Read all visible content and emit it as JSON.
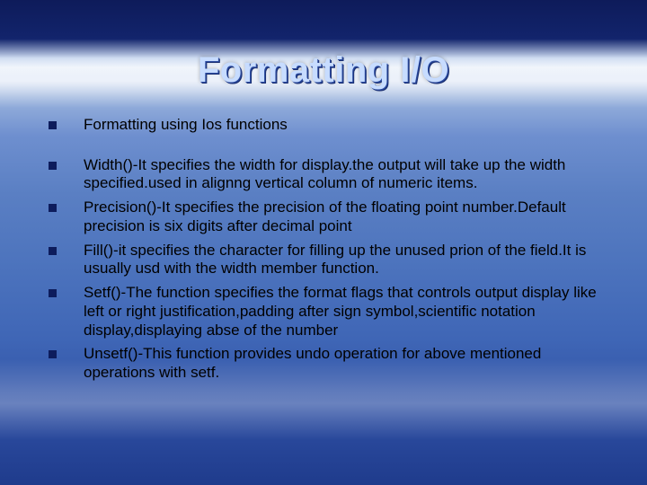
{
  "title": "Formatting I/O",
  "lead": "Formatting using Ios functions",
  "bullets": [
    "Width()-It specifies the width for display.the output will take up the width specified.used in alignng vertical column of numeric items.",
    "Precision()-It specifies the precision of the floating point number.Default precision is six digits after decimal point",
    "Fill()-it specifies the character for filling up the unused prion of the field.It is usually usd with the width member function.",
    "Setf()-The function specifies the format flags that controls output display  like left  or right justification,padding after sign symbol,scientific notation display,displaying abse of the number",
    "Unsetf()-This function provides undo operation for above mentioned operations with setf."
  ]
}
